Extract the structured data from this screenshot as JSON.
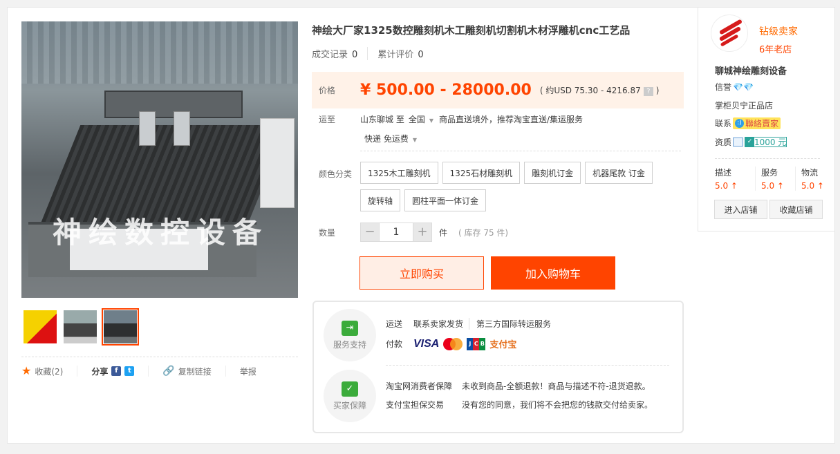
{
  "product": {
    "title": "神绘大厂家1325数控雕刻机木工雕刻机切割机木材浮雕机cnc工艺品",
    "watermark": "神绘数控设备",
    "stats": [
      {
        "label": "成交记录",
        "value": "0"
      },
      {
        "label": "累计评价",
        "value": "0"
      }
    ],
    "price_label": "价格",
    "price": "¥ 500.00 - 28000.00",
    "usd_open": "( 约USD 75.30 - 4216.87",
    "usd_help": "?",
    "usd_close": ")",
    "shipping_label": "运至",
    "origin": "山东聊城 至",
    "destination": "全国",
    "shipping_note": "商品直送境外，推荐淘宝直送/集运服务",
    "express": "快递 免运费",
    "color_label": "颜色分类",
    "options": [
      "1325木工雕刻机",
      "1325石材雕刻机",
      "雕刻机订金",
      "机器尾款 订金",
      "旋转轴",
      "圆柱平面一体订金"
    ],
    "qty_label": "数量",
    "qty_minus": "−",
    "qty_plus": "+",
    "qty": "1",
    "unit": "件",
    "stock": "( 库存 75 件)",
    "buy_now": "立即购买",
    "add_cart": "加入购物车"
  },
  "gallery": {
    "favorite": "收藏(2)",
    "share": "分享",
    "facebook_glyph": "f",
    "twitter_glyph": "t",
    "copy_link": "复制链接",
    "report": "举报"
  },
  "service": {
    "support_label": "服务支持",
    "shipping_key": "运送",
    "contact_seller": "联系卖家发货",
    "third_party": "第三方国际转运服务",
    "payment_key": "付款",
    "visa": "VISA",
    "jcb_letters": [
      "J",
      "C",
      "B"
    ],
    "alipay": "支付宝",
    "guarantee_label": "买家保障",
    "guarantees": [
      {
        "k": "淘宝网消费者保障",
        "v": "未收到商品-全额退款！商品与描述不符-退货退款。"
      },
      {
        "k": "支付宝担保交易",
        "v": "没有您的同意，我们将不会把您的钱款交付给卖家。"
      }
    ]
  },
  "seller": {
    "level": "钻级卖家",
    "age": "6年老店",
    "shop_name": "聊城神绘雕刻设备",
    "credit_label": "信誉",
    "credit_diamonds": "💎💎",
    "keeper": "掌柜贝宁正品店",
    "contact_label": "联系",
    "contact_button": "聯絡賣家",
    "qual_label": "资质",
    "bond": "1000 元",
    "scores": [
      {
        "name": "描述",
        "value": "5.0 ↑"
      },
      {
        "name": "服务",
        "value": "5.0 ↑"
      },
      {
        "name": "物流",
        "value": "5.0 ↑"
      }
    ],
    "enter_shop": "进入店铺",
    "fav_shop": "收藏店铺"
  },
  "colors": {
    "accent": "#ff4400",
    "price_bg": "#fff2e8",
    "seller_level": "#ff6a00"
  }
}
